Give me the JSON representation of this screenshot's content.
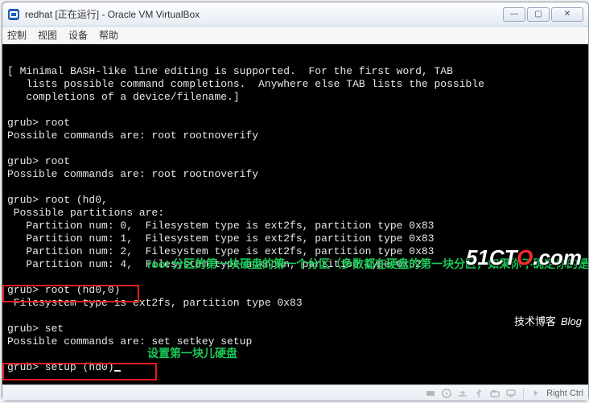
{
  "window": {
    "title": "redhat [正在运行] - Oracle VM VirtualBox",
    "min_glyph": "—",
    "max_glyph": "▢",
    "close_glyph": "✕"
  },
  "menubar": {
    "items": [
      "控制",
      "视图",
      "设备",
      "帮助"
    ]
  },
  "term": {
    "intro1": "[ Minimal BASH-like line editing is supported.  For the first word, TAB",
    "intro2": "   lists possible command completions.  Anywhere else TAB lists the possible",
    "intro3": "   completions of a device/filename.]",
    "p1": "grub> root",
    "p1r": "Possible commands are: root rootnoverify",
    "p2": "grub> root",
    "p2r": "Possible commands are: root rootnoverify",
    "p3": "grub> root (hd0,",
    "p3r": " Possible partitions are:",
    "pt0": "   Partition num: 0,  Filesystem type is ext2fs, partition type 0x83",
    "pt1": "   Partition num: 1,  Filesystem type is ext2fs, partition type 0x83",
    "pt2": "   Partition num: 2,  Filesystem type is ext2fs, partition type 0x83",
    "pt4": "   Partition num: 4,  Filesystem type unknown, partition type 0x82",
    "p4": "grub> root (hd0,0)",
    "p4r": " Filesystem type is ext2fs, partition type 0x83",
    "p5": "grub> set",
    "p5r": "Possible commands are: set setkey setup",
    "p6": "grub> setup (hd0)"
  },
  "annotations": {
    "a": "root 分区的第一块硬盘的第一个分区（多数都在硬盘的第一块分区，如果你不确定你的是那一个的话，你可以一个一个的试试看",
    "b": "设置第一块儿硬盘"
  },
  "status": {
    "hostkey": "Right Ctrl",
    "icons": [
      "hdd-icon",
      "cd-icon",
      "net-icon",
      "usb-icon",
      "shared-icon",
      "display-icon",
      "mouse-icon"
    ]
  },
  "watermark": {
    "brand_pre": "51CT",
    "brand_o": "O",
    "brand_suf": ".com",
    "sub": "技术博客",
    "blog": "Blog"
  }
}
